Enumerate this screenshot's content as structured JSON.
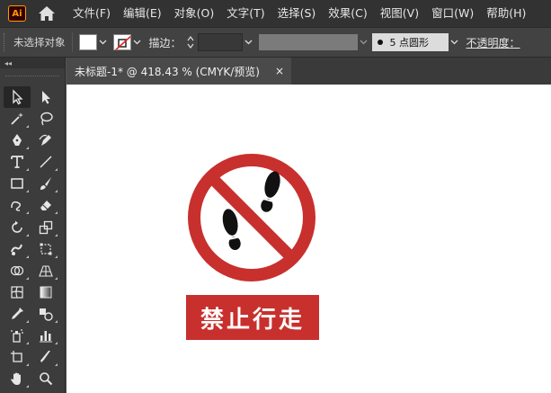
{
  "app": {
    "logo_text": "Ai"
  },
  "menu": {
    "items": [
      {
        "label": "文件(F)"
      },
      {
        "label": "编辑(E)"
      },
      {
        "label": "对象(O)"
      },
      {
        "label": "文字(T)"
      },
      {
        "label": "选择(S)"
      },
      {
        "label": "效果(C)"
      },
      {
        "label": "视图(V)"
      },
      {
        "label": "窗口(W)"
      },
      {
        "label": "帮助(H)"
      }
    ]
  },
  "control": {
    "selection_label": "未选择对象",
    "stroke_label": "描边：",
    "brush_value": "5 点圆形",
    "opacity_label": "不透明度："
  },
  "toolbar": {
    "collapse_glyph": "◂◂",
    "tools": [
      "selection-tool",
      "direct-selection-tool",
      "magic-wand-tool",
      "lasso-tool",
      "pen-tool",
      "curvature-tool",
      "type-tool",
      "line-segment-tool",
      "rectangle-tool",
      "paintbrush-tool",
      "shaper-tool",
      "eraser-tool",
      "rotate-tool",
      "scale-tool",
      "warp-tool",
      "free-transform-tool",
      "shape-builder-tool",
      "perspective-grid-tool",
      "mesh-tool",
      "gradient-tool",
      "eyedropper-tool",
      "blend-tool",
      "symbol-sprayer-tool",
      "column-graph-tool",
      "artboard-tool",
      "slice-tool",
      "hand-tool",
      "zoom-tool"
    ]
  },
  "document": {
    "tab_title": "未标题-1* @ 418.43 % (CMYK/预览)",
    "close_glyph": "×"
  },
  "artwork": {
    "label_text": "禁止行走",
    "colors": {
      "sign_red": "#c8302d",
      "footprint": "#111111",
      "canvas": "#ffffff"
    }
  }
}
